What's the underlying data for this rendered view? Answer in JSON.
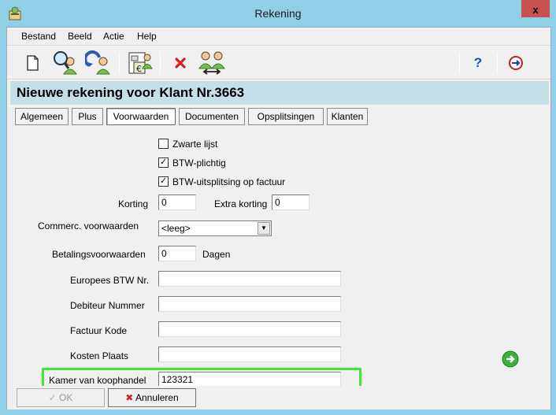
{
  "window": {
    "title": "Rekening",
    "close_label": "x"
  },
  "menu": {
    "items": [
      "Bestand",
      "Beeld",
      "Actie",
      "Help"
    ]
  },
  "toolbar": {
    "buttons": [
      "new-document-icon",
      "search-person-icon",
      "refresh-person-icon",
      "invoice-euro-icon",
      "delete-icon",
      "exchange-persons-icon",
      "help-icon",
      "exit-icon"
    ],
    "help_glyph": "?"
  },
  "header": {
    "title": "Nieuwe rekening voor Klant Nr.3663"
  },
  "tabs": [
    {
      "label": "Algemeen"
    },
    {
      "label": "Plus"
    },
    {
      "label": "Voorwaarden"
    },
    {
      "label": "Documenten"
    },
    {
      "label": "Opsplitsingen"
    },
    {
      "label": "Klanten"
    }
  ],
  "active_tab": "Voorwaarden",
  "form": {
    "zwarte_lijst": {
      "label": "Zwarte lijst",
      "checked": false
    },
    "btw_plichtig": {
      "label": "BTW-plichtig",
      "checked": true
    },
    "btw_uitsplitsing": {
      "label": "BTW-uitsplitsing op factuur",
      "checked": true
    },
    "korting": {
      "label": "Korting",
      "value": "0"
    },
    "extra_korting": {
      "label": "Extra korting",
      "value": "0"
    },
    "commerc_voorwaarden": {
      "label": "Commerc. voorwaarden",
      "value": "<leeg>"
    },
    "betalingsvoorwaarden": {
      "label": "Betalingsvoorwaarden",
      "value": "0",
      "unit": "Dagen"
    },
    "europees_btw": {
      "label": "Europees BTW Nr.",
      "value": ""
    },
    "debiteur_nummer": {
      "label": "Debiteur Nummer",
      "value": ""
    },
    "factuur_kode": {
      "label": "Factuur Kode",
      "value": ""
    },
    "kosten_plaats": {
      "label": "Kosten Plaats",
      "value": ""
    },
    "kamer_van_koophandel": {
      "label": "Kamer van koophandel",
      "value": "123321"
    }
  },
  "buttons": {
    "ok": "OK",
    "cancel": "Annuleren"
  },
  "colors": {
    "titlebar": "#8fd0e8",
    "header_band": "#c5dfe8",
    "highlight": "#3ee63a",
    "close": "#c75050"
  }
}
